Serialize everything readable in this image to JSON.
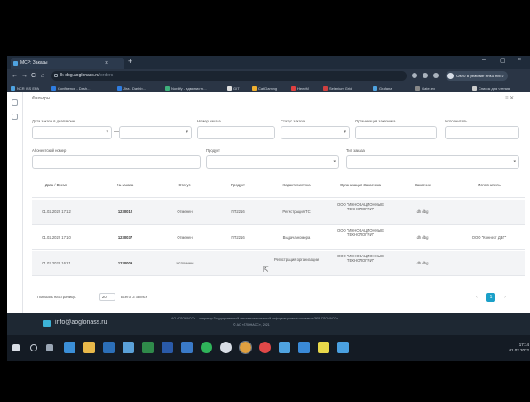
{
  "browser": {
    "tab_title": "МСР: Заказы",
    "tab_close": "×",
    "new_tab": "+",
    "win_min": "–",
    "win_max": "▢",
    "win_close": "×",
    "back": "←",
    "forward": "→",
    "reload": "C",
    "home": "⌂",
    "url_host": "lk-dbg.aoglonass.ru",
    "url_path": "/orders",
    "profile_label": "Окно в режиме инкогнито",
    "bookmarks": [
      {
        "label": "NCR ISS EPA",
        "color": "#4fa3e0"
      },
      {
        "label": "Confluence - Dash...",
        "color": "#2f7de1"
      },
      {
        "label": "Jira - Dashb...",
        "color": "#2f7de1"
      },
      {
        "label": "Nordify - администр...",
        "color": "#3fb17c"
      },
      {
        "label": "GIT",
        "color": "#e0e0e0"
      },
      {
        "label": "CatlGaming",
        "color": "#f0b030"
      },
      {
        "label": "НелеМ",
        "color": "#e04040"
      },
      {
        "label": "Selenium Grid",
        "color": "#d04040"
      },
      {
        "label": "Grafana",
        "color": "#4fa3e0"
      },
      {
        "label": "Gate.tex",
        "color": "#888"
      },
      {
        "label": "Список для чтения",
        "color": "#ccc"
      }
    ]
  },
  "filters": {
    "title": "Фильтры",
    "fields": [
      {
        "label": "Дата заказа в диапазоне",
        "value": "",
        "caret": "▾"
      },
      {
        "label": "",
        "value": "",
        "caret": "▾"
      },
      {
        "label": "Номер заказа",
        "value": "",
        "caret": ""
      },
      {
        "label": "Статус заказа",
        "value": "",
        "caret": "▾"
      },
      {
        "label": "Организация заказчика",
        "value": "",
        "caret": ""
      },
      {
        "label": "Исполнитель",
        "value": "",
        "caret": ""
      },
      {
        "label": "Абонентский номер",
        "value": "",
        "caret": ""
      },
      {
        "label": "Продукт",
        "value": "",
        "caret": "▾"
      },
      {
        "label": "Тип заказа",
        "value": "",
        "caret": "▾"
      }
    ]
  },
  "table": {
    "columns": [
      "Дата / Время",
      "№ заказа",
      "Статус",
      "Продукт",
      "Характеристика",
      "Организация Заказчика",
      "Заказчик",
      "Исполнитель"
    ],
    "rows": [
      [
        "01.02.2022 17:12",
        "1230012",
        "Отменен",
        "ПП2216",
        "Регистрация ТС",
        "ООО \"ИННОВАЦИОННЫЕ ТЕХНОЛОГИИ\"",
        "dh dbg",
        ""
      ],
      [
        "01.02.2022 17:10",
        "1230037",
        "Отменен",
        "ПП2216",
        "Выдача номера",
        "ООО \"ИННОВАЦИОННЫЕ ТЕХНОЛОГИИ\"",
        "dh dbg",
        "ООО \"Коннект ДБГ\""
      ],
      [
        "01.02.2022 16:21",
        "1230009",
        "Исполнен",
        "",
        "Регистрация организации",
        "ООО \"ИННОВАЦИОННЫЕ ТЕХНОЛОГИИ\"",
        "dh dbg",
        ""
      ]
    ]
  },
  "pager": {
    "label": "Показать на странице:",
    "per_page": "20",
    "total": "Всего: 3 записи",
    "prev": "‹",
    "page": "1",
    "next": "›"
  },
  "footer": {
    "email": "info@aoglonass.ru",
    "line1": "АО «ГЛОНАСС» – оператор Государственной автоматизированной информационной системы «ЭРА-ГЛОНАСС»",
    "line2": "© АО «ГЛОНАСС», 2021"
  },
  "taskbar": {
    "time": "17:14",
    "date": "01.02.2022"
  }
}
